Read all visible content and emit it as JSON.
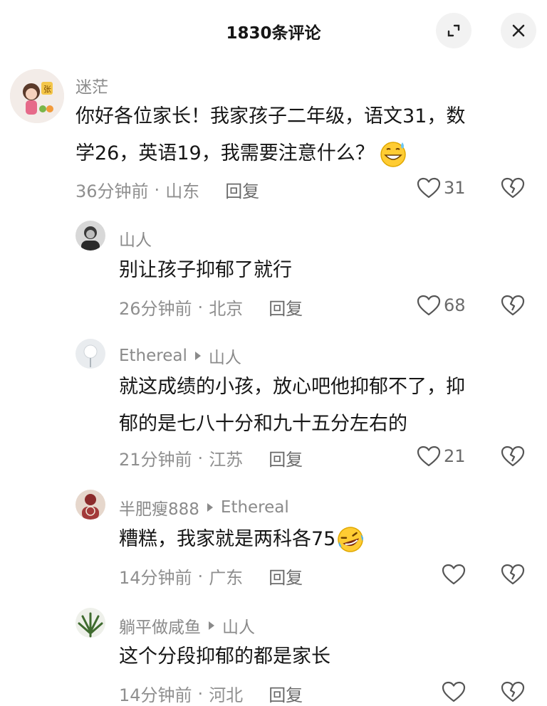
{
  "header": {
    "title": "1830条评论"
  },
  "comments": [
    {
      "user": "迷茫",
      "reply_to": "",
      "text_line1": "你好各位家长！我家孩子二年级，语文31，数",
      "text_line2": "学26，英语19，我需要注意什么？",
      "emoji": "sweat-smile-emoji",
      "time": "36分钟前",
      "location": "山东",
      "reply_label": "回复",
      "likes": "31"
    },
    {
      "user": "山人",
      "reply_to": "",
      "text_line1": "别让孩子抑郁了就行",
      "time": "26分钟前",
      "location": "北京",
      "reply_label": "回复",
      "likes": "68"
    },
    {
      "user": "Ethereal",
      "reply_to": "山人",
      "text_line1": "就这成绩的小孩，放心吧他抑郁不了，抑",
      "text_line2": "郁的是七八十分和九十五分左右的",
      "time": "21分钟前",
      "location": "江苏",
      "reply_label": "回复",
      "likes": "21"
    },
    {
      "user": "半肥瘦888",
      "reply_to": "Ethereal",
      "text_line1": "糟糕，我家就是两科各75",
      "emoji": "rofl-emoji",
      "time": "14分钟前",
      "location": "广东",
      "reply_label": "回复",
      "likes": ""
    },
    {
      "user": "躺平做咸鱼",
      "reply_to": "山人",
      "text_line1": "这个分段抑郁的都是家长",
      "time": "14分钟前",
      "location": "河北",
      "reply_label": "回复",
      "likes": ""
    }
  ],
  "meta_separator": "·",
  "colors": {
    "text": "#161616",
    "muted": "#8a8a8a",
    "button_bg": "#f2f2f2"
  }
}
